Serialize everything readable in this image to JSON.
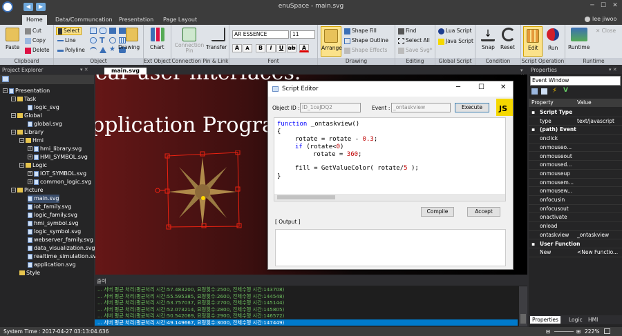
{
  "app": {
    "title": "enuSpace - main.svg",
    "user": "lee jiwoo"
  },
  "tabs": [
    "Home",
    "Data/Communcation",
    "Presentation",
    "Page Layout"
  ],
  "ribbon": {
    "clipboard": {
      "label": "Clipboard",
      "paste": "Paste",
      "cut": "Cut",
      "copy": "Copy",
      "delete": "Delete"
    },
    "object": {
      "label": "Object",
      "select": "Select",
      "line": "Line",
      "polyline": "Polyline",
      "drawing": "Drawing"
    },
    "ext_object": {
      "label": "Ext Object",
      "chart": "Chart"
    },
    "connection": {
      "label": "Connection Pin & Link",
      "connection_pin": "Connection Pin",
      "transfer": "Transfer"
    },
    "font": {
      "label": "Font",
      "family": "AR ESSENCE",
      "size": "11"
    },
    "drawing": {
      "label": "Drawing",
      "arrange": "Arrange",
      "shape_fill": "Shape Fill",
      "shape_outline": "Shape Outline",
      "shape_effects": "Shape Effects"
    },
    "editing": {
      "label": "Editing",
      "find": "Find",
      "select_all": "Select All",
      "save_svg": "Save Svg*"
    },
    "global_script": {
      "label": "Global Script",
      "lua": "Lua Script",
      "java": "Java Script"
    },
    "condition": {
      "label": "Condition",
      "snap": "Snap",
      "reset": "Reset"
    },
    "script_operation": {
      "label": "Script Operation",
      "edit": "Edit",
      "run": "Run"
    },
    "runtime": {
      "label": "Runtime",
      "runtime": "Runtime",
      "close": "Close"
    }
  },
  "project_explorer": {
    "title": "Project Explorer",
    "items": [
      {
        "label": "Presentation"
      },
      {
        "label": "Task"
      },
      {
        "label": "logic_svg"
      },
      {
        "label": "Global"
      },
      {
        "label": "global.svg"
      },
      {
        "label": "Library"
      },
      {
        "label": "Hmi"
      },
      {
        "label": "hmi_library.svg"
      },
      {
        "label": "HMI_SYMBOL.svg"
      },
      {
        "label": "Logic"
      },
      {
        "label": "IOT_SYMBOL.svg"
      },
      {
        "label": "common_logic.svg"
      },
      {
        "label": "Picture"
      },
      {
        "label": "main.svg"
      },
      {
        "label": "iot_family.svg"
      },
      {
        "label": "logic_family.svg"
      },
      {
        "label": "hmi_symbol.svg"
      },
      {
        "label": "logic_symbol.svg"
      },
      {
        "label": "webserver_family.svg"
      },
      {
        "label": "data_visualization.svg"
      },
      {
        "label": "realtime_simulation.svg"
      },
      {
        "label": "application.svg"
      },
      {
        "label": "Style"
      }
    ]
  },
  "document": {
    "tab": "main.svg",
    "line1": "ear user interfaces.",
    "line2": "pplication Program"
  },
  "script_editor": {
    "title": "Script Editor",
    "object_id_label": "Object ID :",
    "object_id": "ID_1ceJDQ2",
    "event_label": "Event :",
    "event": "_ontaskview",
    "execute": "Execute",
    "js_badge": "JS",
    "code": {
      "l1_kw": "function",
      "l1": " _ontaskview()",
      "l2": "{",
      "l3": "rotate = rotate - ",
      "l3_num": "0.3",
      "l3_end": ";",
      "l4_kw": "if",
      "l4a": " (rotate<",
      "l4_num": "0",
      "l4b": ")",
      "l5": "rotate = ",
      "l5_num": "360",
      "l5_end": ";",
      "l6a": "fill = GetValueColor( rotate/",
      "l6_num": "5",
      "l6b": " );",
      "l7": "}"
    },
    "compile": "Compile",
    "accept": "Accept",
    "output_label": "[ Output ]"
  },
  "output": {
    "title": "출력",
    "lines": [
      "... 서버 평균 처리(평균처리 시간:57.483200, 요청횟수:2500, 전체수행 시간:143708)",
      "... 서버 평균 처리(평균처리 시간:55.595385, 요청횟수:2600, 전체수행 시간:144548)",
      "... 서버 평균 처리(평균처리 시간:53.757037, 요청횟수:2700, 전체수행 시간:145144)",
      "... 서버 평균 처리(평균처리 시간:52.073214, 요청횟수:2800, 전체수행 시간:145805)",
      "... 서버 평균 처리(평균처리 시간:50.542069, 요청횟수:2900, 전체수행 시간:146572)",
      "... 서버 평균 처리(평균처리 시간:49.149667, 요청횟수:3000, 전체수행 시간:147449)"
    ]
  },
  "properties": {
    "title": "Properties",
    "window": "Event Window",
    "col_property": "Property",
    "col_value": "Value",
    "rows": [
      {
        "k": "Script Type",
        "v": ""
      },
      {
        "k": "type",
        "v": "text/javascript"
      },
      {
        "k": "(path) Event",
        "v": ""
      },
      {
        "k": "onclick",
        "v": ""
      },
      {
        "k": "onmouseo...",
        "v": ""
      },
      {
        "k": "onmouseout",
        "v": ""
      },
      {
        "k": "onmoused...",
        "v": ""
      },
      {
        "k": "onmouseup",
        "v": ""
      },
      {
        "k": "onmousem...",
        "v": ""
      },
      {
        "k": "onmousew...",
        "v": ""
      },
      {
        "k": "onfocusin",
        "v": ""
      },
      {
        "k": "onfocusout",
        "v": ""
      },
      {
        "k": "onactivate",
        "v": ""
      },
      {
        "k": "onload",
        "v": ""
      },
      {
        "k": "ontaskview",
        "v": "_ontaskview"
      },
      {
        "k": "User Function",
        "v": ""
      },
      {
        "k": "New",
        "v": "<New Functio..."
      }
    ],
    "bottom_tabs": [
      "Properties",
      "Logic",
      "HMI"
    ]
  },
  "status": {
    "time": "System Time : 2017-04-27 03:13:04.636",
    "zoom": "222%"
  }
}
